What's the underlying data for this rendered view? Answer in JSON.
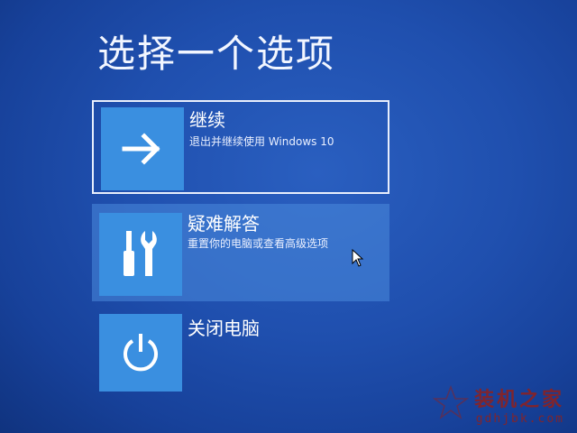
{
  "screen": {
    "title": "选择一个选项"
  },
  "options": [
    {
      "title": "继续",
      "description": "退出并继续使用 Windows 10",
      "icon": "arrow-right-icon"
    },
    {
      "title": "疑难解答",
      "description": "重置你的电脑或查看高级选项",
      "icon": "tools-icon"
    },
    {
      "title": "关闭电脑",
      "description": "",
      "icon": "power-icon"
    }
  ],
  "colors": {
    "background": "#1f4fae",
    "tile": "#3a8fe0"
  },
  "watermark": {
    "name": "装机之家",
    "url": "gdhjbk.com"
  }
}
